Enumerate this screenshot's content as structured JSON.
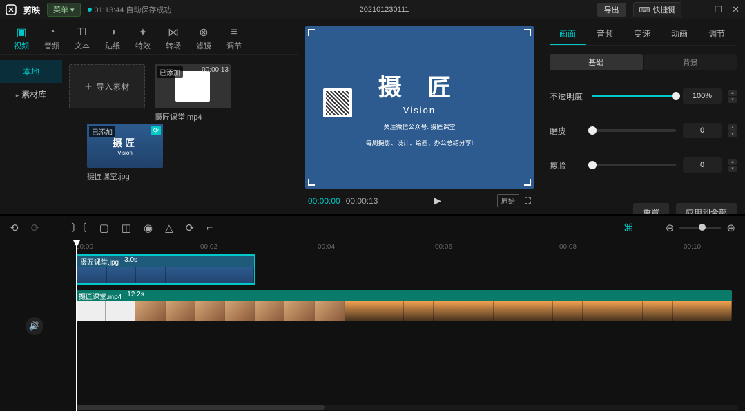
{
  "titlebar": {
    "appname": "剪映",
    "menu_label": "菜单",
    "autosave": "01:13:44 自动保存成功",
    "project_name": "202101230111",
    "export_label": "导出",
    "shortcut_label": "快捷键"
  },
  "tool_tabs": [
    {
      "label": "视频",
      "active": true
    },
    {
      "label": "音频",
      "active": false
    },
    {
      "label": "文本",
      "active": false
    },
    {
      "label": "贴纸",
      "active": false
    },
    {
      "label": "特效",
      "active": false
    },
    {
      "label": "转场",
      "active": false
    },
    {
      "label": "滤镜",
      "active": false
    },
    {
      "label": "调节",
      "active": false
    }
  ],
  "media_side": {
    "local": "本地",
    "library": "素材库"
  },
  "media": {
    "import_label": "导入素材",
    "added_badge": "已添加",
    "items": [
      {
        "filename": "摄匠课堂.mp4",
        "duration": "00:00:13"
      },
      {
        "filename": "摄匠课堂.jpg"
      }
    ]
  },
  "preview": {
    "brand": "摄 匠",
    "vision": "Vision",
    "sub1": "关注微信公众号: 摄匠课堂",
    "sub2": "每周摄影、设计、绘画、办公总结分享!",
    "current_time": "00:00:00",
    "total_time": "00:00:13",
    "ratio_label": "原始"
  },
  "inspector": {
    "tabs": [
      "画面",
      "音频",
      "变速",
      "动画",
      "调节"
    ],
    "sub_tabs": {
      "basic": "基础",
      "background": "背景"
    },
    "props": {
      "opacity_label": "不透明度",
      "opacity_value": "100%",
      "smooth_label": "磨皮",
      "smooth_value": "0",
      "slim_label": "瘦脸",
      "slim_value": "0"
    },
    "reset_label": "重置",
    "apply_all_label": "应用到全部"
  },
  "timeline": {
    "ruler": [
      "00:00",
      "00:02",
      "00:04",
      "00:06",
      "00:08",
      "00:10"
    ],
    "clips": [
      {
        "name": "摄匠课堂.jpg",
        "duration": "3.0s"
      },
      {
        "name": "摄匠课堂.mp4",
        "duration": "12.2s"
      }
    ]
  }
}
